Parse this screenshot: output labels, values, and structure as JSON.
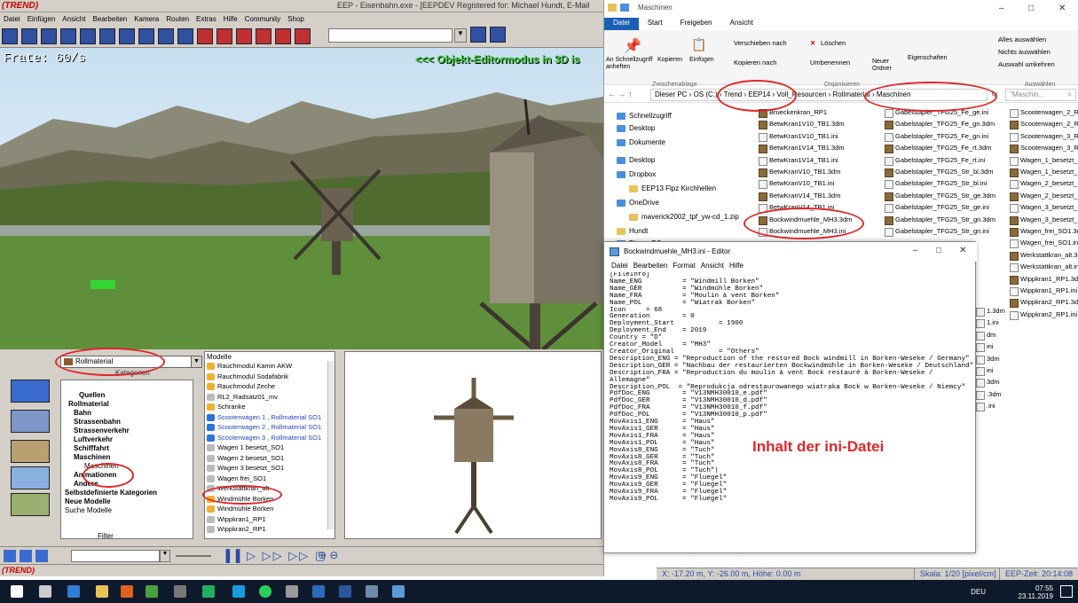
{
  "eep": {
    "title": "EEP - Eisenbahn.exe - [EEPDEV Registered for: Michael Hundt, E-Mail",
    "logo": "(TREND)",
    "menu": [
      "Datei",
      "Einfügen",
      "Ansicht",
      "Bearbeiten",
      "Kamera",
      "Routen",
      "Extras",
      "Hilfe",
      "Community",
      "Shop"
    ],
    "frame_rate": "Frate: 60/s",
    "mode_text": "<<< Objekt-Editormodus in 3D is",
    "category_select": "Rollmaterial",
    "category_label": "Kategorien",
    "tree": [
      {
        "label": "Quellen",
        "bold": true
      },
      {
        "label": "Rollmaterial",
        "bold": true
      },
      {
        "label": "Bahn",
        "bold": true
      },
      {
        "label": "Strassenbahn",
        "bold": true
      },
      {
        "label": "Strassenverkehr",
        "bold": true
      },
      {
        "label": "Luftverkehr",
        "bold": true
      },
      {
        "label": "Schifffahrt",
        "bold": true
      },
      {
        "label": "Maschinen",
        "bold": true
      },
      {
        "label": "Maschinen",
        "bold": false
      },
      {
        "label": "Animationen",
        "bold": true
      },
      {
        "label": "Andere",
        "bold": true
      },
      {
        "label": "Selbstdefinierte Kategorien",
        "bold": true
      },
      {
        "label": "Neue Modelle",
        "bold": true
      },
      {
        "label": "Suche Modelle",
        "bold": false
      }
    ],
    "filter_label": "Filter",
    "models_title": "Modelle",
    "models": [
      {
        "label": "Rauchmodul Kamin AKW",
        "kind": "orange"
      },
      {
        "label": "Rauchmodul Sodafabrik",
        "kind": "orange"
      },
      {
        "label": "Rauchmodul Zeche",
        "kind": "orange"
      },
      {
        "label": "RL2_Radsatz01_mv",
        "kind": "gray"
      },
      {
        "label": "Schranke",
        "kind": "orange"
      },
      {
        "label": "Scooterwagen 1 , Rollmaterial SO1",
        "kind": "blue"
      },
      {
        "label": "Scooterwagen 2 , Rollmaterial SO1",
        "kind": "blue"
      },
      {
        "label": "Scooterwagen 3 , Rollmaterial SO1",
        "kind": "blue"
      },
      {
        "label": "Wagen 1 besetzt_SO1",
        "kind": "gray"
      },
      {
        "label": "Wagen 2 besetzt_SO1",
        "kind": "gray"
      },
      {
        "label": "Wagen 3 besetzt_SO1",
        "kind": "gray"
      },
      {
        "label": "Wagen frei_SO1",
        "kind": "gray"
      },
      {
        "label": "Werkstattkran_alt",
        "kind": "gray"
      },
      {
        "label": "Windmühle Borken",
        "kind": "orange"
      },
      {
        "label": "Windmühle Borken",
        "kind": "orange"
      },
      {
        "label": "Wippkran1_RP1",
        "kind": "gray"
      },
      {
        "label": "Wippkran2_RP1",
        "kind": "gray"
      }
    ],
    "status_logo": "(TREND)",
    "coords": "X: -17.20 m, Y: -26.00 m, Höhe: 0.00 m",
    "scale": "Skala: 1/20 [pixel/cm]",
    "eep_time": "EEP-Zeit: 20:14:08"
  },
  "explorer": {
    "title": "Maschinen",
    "tabs": [
      "Datei",
      "Start",
      "Freigeben",
      "Ansicht"
    ],
    "ribbon": {
      "pin": "An Schnellzugriff anheften",
      "copy": "Kopieren",
      "paste": "Einfügen",
      "move_to": "Verschieben nach",
      "copy_to": "Kopieren nach",
      "delete": "Löschen",
      "rename": "Umbenennen",
      "new_folder": "Neuer Ordner",
      "properties": "Eigenschaften",
      "select_all": "Alles auswählen",
      "select_none": "Nichts auswählen",
      "invert_selection": "Auswahl umkehren",
      "group_clipboard": "Zwischenablage",
      "group_organize": "Organisieren",
      "group_select": "Auswählen"
    },
    "address": [
      "Dieser PC",
      "OS (C:)",
      "Trend",
      "EEP14",
      "Voll_Resourcen",
      "Rollmaterial",
      "Maschinen"
    ],
    "search_placeholder": "\"Maschin...",
    "nav": [
      {
        "label": "Schnellzugriff",
        "kind": "star"
      },
      {
        "label": "Desktop",
        "kind": "blue"
      },
      {
        "label": "Dokumente",
        "kind": "blue"
      },
      {
        "label": "Desktop",
        "kind": "blue"
      },
      {
        "label": "Dropbox",
        "kind": "blue"
      },
      {
        "label": "EEP13 Flpz Kirchhellen",
        "kind": "folder"
      },
      {
        "label": "OneDrive",
        "kind": "blue"
      },
      {
        "label": "maverick2002_tpf_yw-cd_1.zip",
        "kind": "folder"
      },
      {
        "label": "Hundt",
        "kind": "folder"
      },
      {
        "label": "Dieser PC",
        "kind": "blue"
      }
    ],
    "files_col1": [
      {
        "label": "Brueckenkran_RP1",
        "t": "d3"
      },
      {
        "label": "BetwKran1V10_TB1.3dm",
        "t": "d3"
      },
      {
        "label": "BetwKran1V10_TB1.ini",
        "t": "ini"
      },
      {
        "label": "BetwKran1V14_TB1.3dm",
        "t": "d3"
      },
      {
        "label": "BetwKran1V14_TB1.ini",
        "t": "ini"
      },
      {
        "label": "BetwKranV10_TB1.3dm",
        "t": "d3"
      },
      {
        "label": "BetwKranV10_TB1.ini",
        "t": "ini"
      },
      {
        "label": "BetwKranV14_TB1.3dm",
        "t": "d3"
      },
      {
        "label": "BetwKranV14_TB1.ini",
        "t": "ini"
      },
      {
        "label": "Bockwindmuehle_MH3.3dm",
        "t": "d3"
      },
      {
        "label": "Bockwindmuehle_MH3.ini",
        "t": "ini"
      }
    ],
    "files_col2": [
      {
        "label": "Gabelstapler_TFG25_Fe_ge.ini",
        "t": "ini"
      },
      {
        "label": "Gabelstapler_TFG25_Fe_gn.3dm",
        "t": "d3"
      },
      {
        "label": "Gabelstapler_TFG25_Fe_gn.ini",
        "t": "ini"
      },
      {
        "label": "Gabelstapler_TFG25_Fe_rt.3dm",
        "t": "d3"
      },
      {
        "label": "Gabelstapler_TFG25_Fe_rt.ini",
        "t": "ini"
      },
      {
        "label": "Gabelstapler_TFG25_Str_bl.3dm",
        "t": "d3"
      },
      {
        "label": "Gabelstapler_TFG25_Str_bl.ini",
        "t": "ini"
      },
      {
        "label": "Gabelstapler_TFG25_Str_ge.3dm",
        "t": "d3"
      },
      {
        "label": "Gabelstapler_TFG25_Str_ge.ini",
        "t": "ini"
      },
      {
        "label": "Gabelstapler_TFG25_Str_gn.3dm",
        "t": "d3"
      },
      {
        "label": "Gabelstapler_TFG25_Str_gn.ini",
        "t": "ini"
      }
    ],
    "files_col3": [
      {
        "label": "Scooterwagen_2_Ro",
        "t": "ini"
      },
      {
        "label": "Scooterwagen_2_Ro",
        "t": "d3"
      },
      {
        "label": "Scooterwagen_3_Ro",
        "t": "ini"
      },
      {
        "label": "Scooterwagen_3_Ro",
        "t": "d3"
      },
      {
        "label": "Wagen_1_besetzt_SO",
        "t": "ini"
      },
      {
        "label": "Wagen_1_besetzt_SO",
        "t": "d3"
      },
      {
        "label": "Wagen_2_besetzt_SO",
        "t": "ini"
      },
      {
        "label": "Wagen_2_besetzt_SO",
        "t": "d3"
      },
      {
        "label": "Wagen_3_besetzt_SO",
        "t": "ini"
      },
      {
        "label": "Wagen_3_besetzt_SO",
        "t": "d3"
      },
      {
        "label": "Wagen_frei_SO1.3dm",
        "t": "d3"
      },
      {
        "label": "Wagen_frei_SO1.ini",
        "t": "ini"
      },
      {
        "label": "Werkstattkran_alt.3c",
        "t": "d3"
      },
      {
        "label": "Werkstattkran_alt.in",
        "t": "ini"
      },
      {
        "label": "Wippkran1_RP1.3dm",
        "t": "d3"
      },
      {
        "label": "Wippkran1_RP1.ini",
        "t": "ini"
      },
      {
        "label": "Wippkran2_RP1.3dm",
        "t": "d3"
      },
      {
        "label": "Wippkran2_RP1.ini",
        "t": "ini"
      }
    ],
    "files_col2_tail": [
      "1.3dm",
      "1.ini",
      "dm",
      "ini",
      "3dm",
      "ini",
      "3dm",
      ".3dm",
      ".ini"
    ]
  },
  "editor": {
    "title": "Bockwindmuehle_MH3.ini - Editor",
    "menu": [
      "Datei",
      "Bearbeiten",
      "Format",
      "Ansicht",
      "Hilfe"
    ],
    "content": "[FileInfo]\nName_ENG          = \"Windmill Borken\"\nName_GER          = \"Windmühle Borken\"\nName_FRA          = \"Moulin à vent Borken\"\nName_POL          = \"Wiatrak Borken\"\nIcon     = 68\nGeneration        = 0\nDeployment_Start           = 1900\nDeployment_End    = 2019\nCountry = \"D\"\nCreator_Model     = \"MH3\"\nCreator_Original           = \"Others\"\nDescription_ENG = \"Reproduction of the restored Bock windmill in Borken-Weseke / Germany\"\nDescription_GER = \"Nachbau der restaurierten Bockwindmühle in Borken-Weseke / Deutschland\"\nDescription_FRA = \"Reproduction du moulin à vent Bock restauré à Borken-Weseke /\nAllemagne\"\nDescription_POL  = \"Reprodukcja odrestaurowanego wiatraka Bock w Borken-Weseke / Niemcy\"\nPdfDoc_ENG        = \"V13NMH30010_e.pdf\"\nPdfDoc_GER        = \"V13NMH30010_d.pdf\"\nPdfDoc_FRA        = \"V13NMH30010_f.pdf\"\nPdfDoc_POL        = \"V13NMH30010_p.pdf\"\nMovAxis1_ENG      = \"Haus\"\nMovAxis1_GER      = \"Haus\"\nMovAxis1_FRA      = \"Haus\"\nMovAxis1_POL      = \"Haus\"\nMovAxis8_ENG      = \"Tuch\"\nMovAxis8_GER      = \"Tuch\"\nMovAxis8_FRA      = \"Tuch\"\nMovAxis8_POL      = \"Tuch\"|\nMovAxis9_ENG      = \"Fluegel\"\nMovAxis9_GER      = \"Fluegel\"\nMovAxis9_FRA      = \"Fluegel\"\nMovAxis9_POL      = \"Fluegel\""
  },
  "annotation": "Inhalt der ini-Datei",
  "taskbar": {
    "lang": "DEU",
    "time": "07:55",
    "date": "23.11.2019"
  }
}
